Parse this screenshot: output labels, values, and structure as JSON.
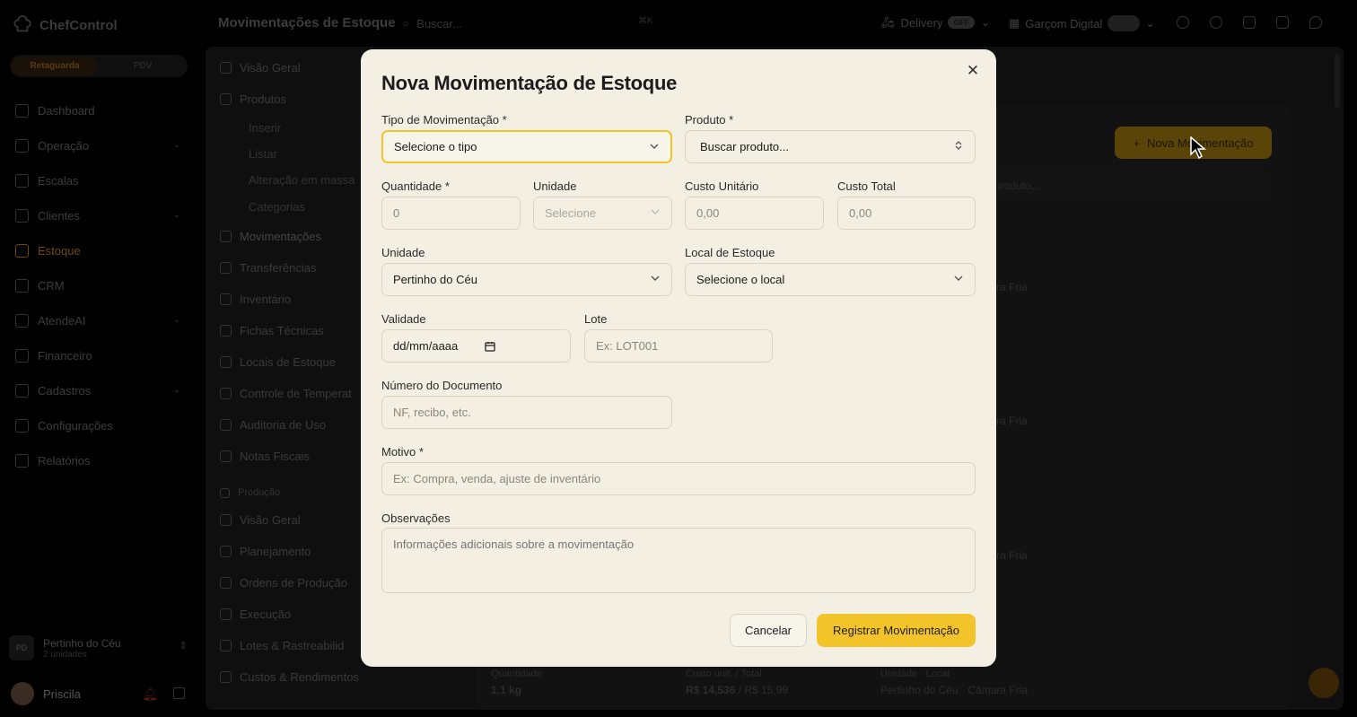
{
  "app": {
    "brand": "ChefControl",
    "mode_active": "Retaguarda",
    "mode_inactive": "PDV"
  },
  "sidebar": {
    "items": [
      {
        "label": "Dashboard",
        "icon": "home-icon"
      },
      {
        "label": "Operação",
        "icon": "clipboard-icon",
        "chevron": true
      },
      {
        "label": "Escalas",
        "icon": "users-icon"
      },
      {
        "label": "Clientes",
        "icon": "user-group-icon",
        "chevron": true
      },
      {
        "label": "Estoque",
        "icon": "box-icon",
        "active": true
      },
      {
        "label": "CRM",
        "icon": "megaphone-icon"
      },
      {
        "label": "AtendeAI",
        "icon": "bot-icon",
        "chevron": true
      },
      {
        "label": "Financeiro",
        "icon": "dollar-icon"
      },
      {
        "label": "Cadastros",
        "icon": "list-icon",
        "chevron": true
      },
      {
        "label": "Configurações",
        "icon": "gear-icon"
      },
      {
        "label": "Relatórios",
        "icon": "bar-chart-icon"
      }
    ],
    "org": {
      "name": "Pertinho do Céu",
      "sub": "2 unidades",
      "initials": "PD"
    },
    "user": {
      "name": "Priscila"
    }
  },
  "topbar": {
    "title": "Movimentações de Estoque",
    "search_placeholder": "Buscar...",
    "shortcut": "⌘K",
    "delivery": "Delivery",
    "delivery_state": "OFF",
    "garcom": "Garçom Digital"
  },
  "subnav": {
    "visao": "Visão Geral",
    "produtos": "Produtos",
    "inserir": "Inserir",
    "listar": "Listar",
    "alteracao": "Alteração em massa",
    "categorias": "Categorias",
    "movimentacoes": "Movimentações",
    "transferencias": "Transferências",
    "inventario": "Inventário",
    "fichas": "Fichas Técnicas",
    "locais": "Locais de Estoque",
    "controle": "Controle de Temperat",
    "auditoria": "Auditoria de Uso",
    "notas": "Notas Fiscais",
    "producao": "Produção",
    "prod_visao": "Visão Geral",
    "planejamento": "Planejamento",
    "ordens": "Ordens de Produção",
    "execucao": "Execução",
    "lotes": "Lotes & Rastreabilid",
    "custos": "Custos & Rendimentos"
  },
  "background": {
    "nova_btn": "Nova Movimentação",
    "search_placeholder": "produto...",
    "camara1": "ra Fria",
    "camara2": "ra Fria",
    "camara3": "ra Fria",
    "row_qty_label": "Quantidade",
    "row_qty": "1,1 kg",
    "row_cost_label": "Custo unit. / Total",
    "row_cost": "R$ 14,536",
    "row_total": " / R$ 15,99",
    "row_loc_label": "Unidade · Local",
    "row_loc": "Pertinho do Céu · Câmara Fria"
  },
  "modal": {
    "title": "Nova Movimentação de Estoque",
    "tipo_label": "Tipo de Movimentação *",
    "tipo_value": "Selecione o tipo",
    "produto_label": "Produto *",
    "produto_placeholder": "Buscar produto...",
    "quantidade_label": "Quantidade *",
    "quantidade_placeholder": "0",
    "unidade_label": "Unidade",
    "unidade_value": "Selecione",
    "custo_unit_label": "Custo Unitário",
    "custo_unit_placeholder": "0,00",
    "custo_total_label": "Custo Total",
    "custo_total_placeholder": "0,00",
    "unidade2_label": "Unidade",
    "unidade2_value": "Pertinho do Céu",
    "local_label": "Local de Estoque",
    "local_value": "Selecione o local",
    "validade_label": "Validade",
    "validade_value": "dd/mm/aaaa",
    "lote_label": "Lote",
    "lote_placeholder": "Ex: LOT001",
    "documento_label": "Número do Documento",
    "documento_placeholder": "NF, recibo, etc.",
    "motivo_label": "Motivo *",
    "motivo_placeholder": "Ex: Compra, venda, ajuste de inventário",
    "obs_label": "Observações",
    "obs_placeholder": "Informações adicionais sobre a movimentação",
    "cancel": "Cancelar",
    "submit": "Registrar Movimentação"
  },
  "colors": {
    "accent": "#f3c42a",
    "modal_bg": "#f3efe3"
  }
}
